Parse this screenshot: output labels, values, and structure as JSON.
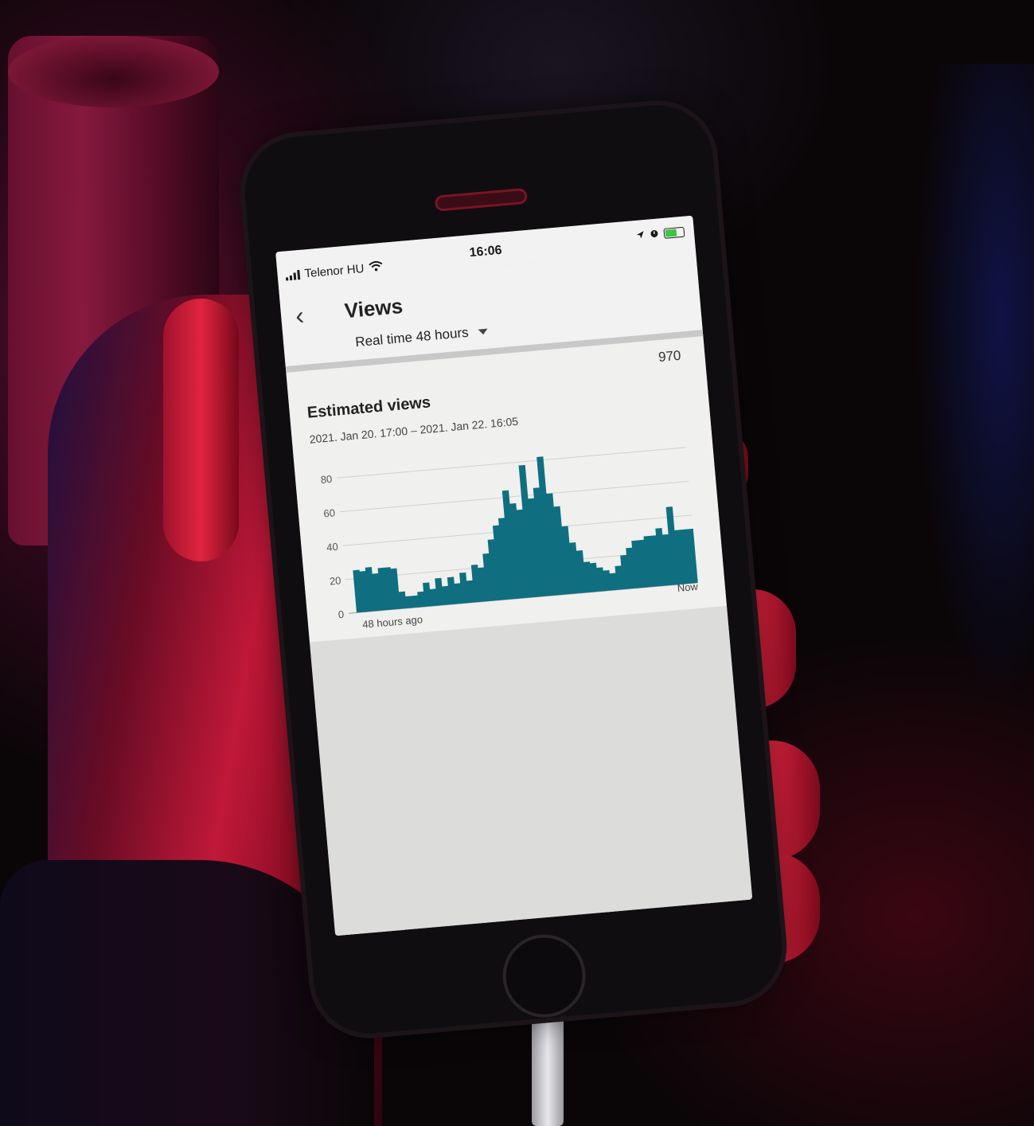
{
  "status_bar": {
    "carrier": "Telenor HU",
    "time": "16:06"
  },
  "header": {
    "title": "Views",
    "period": "Real time 48 hours"
  },
  "card": {
    "total": "970",
    "title": "Estimated views",
    "range": "2021. Jan 20. 17:00 – 2021. Jan 22. 16:05"
  },
  "colors": {
    "bar": "#0f6f80",
    "accent_background": "#f0f0ef"
  },
  "chart_data": {
    "type": "bar",
    "x_start_label": "48 hours ago",
    "x_end_label": "Now",
    "y_ticks": [
      0,
      20,
      40,
      60,
      80
    ],
    "ylim": [
      0,
      90
    ],
    "grid": true,
    "values": [
      25,
      24,
      26,
      22,
      25,
      25,
      24,
      10,
      7,
      7,
      9,
      14,
      10,
      16,
      11,
      16,
      12,
      18,
      13,
      22,
      20,
      28,
      36,
      44,
      48,
      64,
      56,
      52,
      78,
      58,
      64,
      82,
      60,
      52,
      40,
      30,
      25,
      18,
      17,
      14,
      12,
      10,
      14,
      20,
      24,
      28,
      28,
      30,
      30,
      34,
      30,
      46,
      32,
      32,
      32
    ]
  }
}
